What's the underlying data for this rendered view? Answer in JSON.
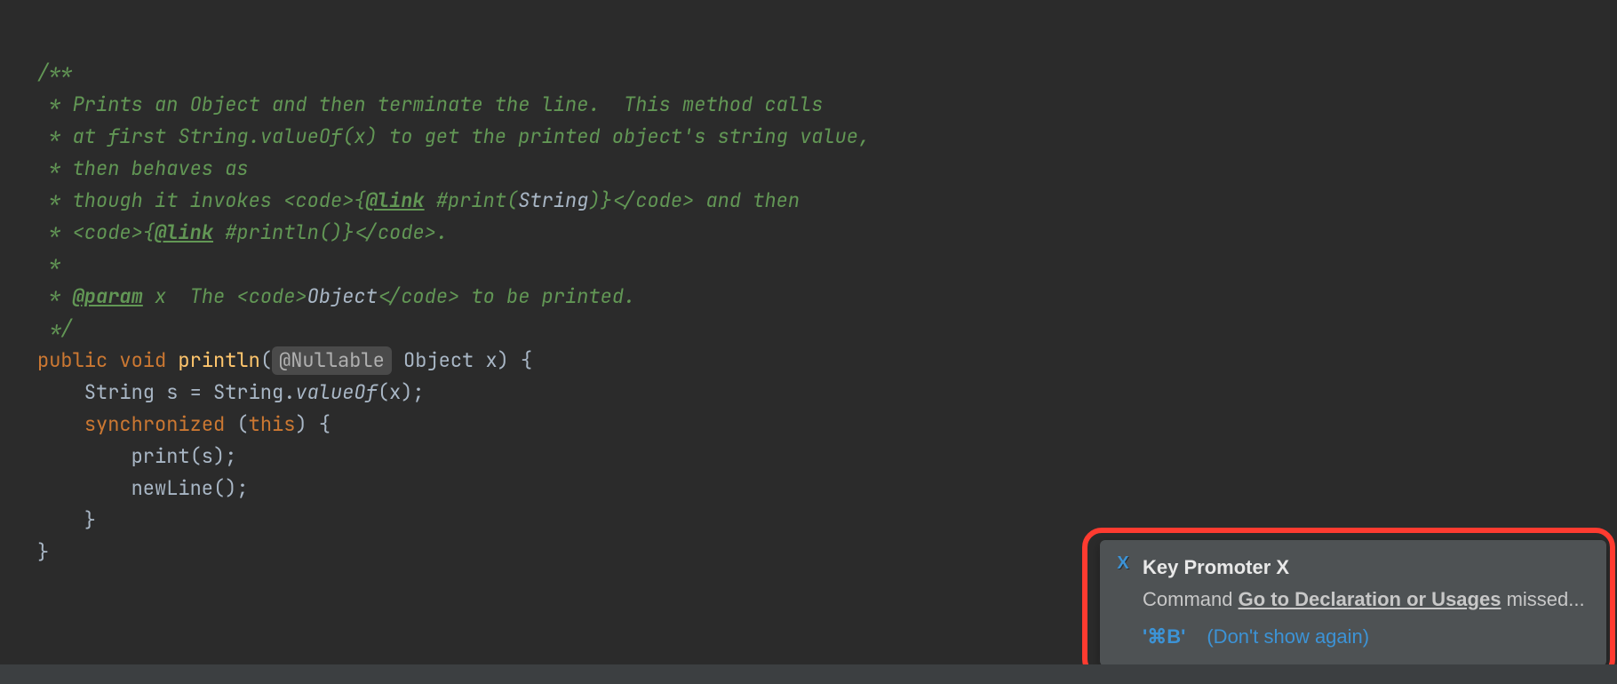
{
  "code": {
    "l1": "/**",
    "l2_a": " * Prints an Object and then terminate the line.  This method calls",
    "l3_a": " * at first String.valueOf(x) to get the printed object's string value,",
    "l4_a": " * then behaves as",
    "l5_a": " * though it invokes ",
    "l5_codeopen": "<code>",
    "l5_brace": "{",
    "l5_link": "@link",
    "l5_rest": " #print(",
    "l5_string": "String",
    "l5_close": ")}",
    "l5_codeclose": "</code>",
    "l5_tail": " and then",
    "l6_a": " * ",
    "l6_codeopen": "<code>",
    "l6_brace": "{",
    "l6_link": "@link",
    "l6_rest": " #println()}",
    "l6_codeclose": "</code>",
    "l6_tail": ".",
    "l7": " *",
    "l8_a": " * ",
    "l8_param": "@param",
    "l8_rest": " x  The ",
    "l8_codeopen": "<code>",
    "l8_obj": "Object",
    "l8_codeclose": "</code>",
    "l8_tail": " to be printed.",
    "l9": " */",
    "sig_public": "public ",
    "sig_void": "void ",
    "sig_name": "println",
    "sig_open": "(",
    "sig_ann": "@Nullable",
    "sig_param": " Object x) {",
    "b1_a": "    String s = String.",
    "b1_b": "valueOf",
    "b1_c": "(x);",
    "b2_a": "    ",
    "b2_sync": "synchronized ",
    "b2_b": "(",
    "b2_this": "this",
    "b2_c": ") {",
    "b3": "        print(s);",
    "b4": "        newLine();",
    "b5": "    }",
    "b6": "}"
  },
  "notification": {
    "title": "Key Promoter X",
    "body_prefix": "Command ",
    "body_link": "Go to Declaration or Usages",
    "body_suffix": " missed...",
    "shortcut": "'⌘B'",
    "dont_show": "(Don't show again)",
    "icon_char": "X"
  }
}
